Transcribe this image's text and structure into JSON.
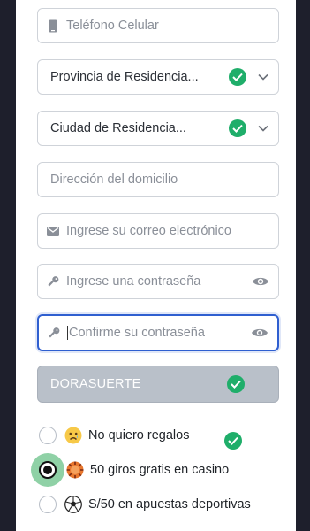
{
  "form": {
    "phone": {
      "placeholder": "Teléfono Celular",
      "icon": "phone-icon"
    },
    "province": {
      "value": "Provincia de Residencia...",
      "valid": true
    },
    "city": {
      "value": "Ciudad de Residencia...",
      "valid": true
    },
    "address": {
      "placeholder": "Dirección del domicilio"
    },
    "email": {
      "placeholder": "Ingrese su correo electrónico",
      "icon": "envelope-icon"
    },
    "password": {
      "placeholder": "Ingrese una contraseña",
      "icon": "key-icon"
    },
    "confirm_password": {
      "placeholder": "Confirme su contraseña",
      "icon": "key-icon"
    },
    "promo_code": {
      "value": "DORASUERTE",
      "valid": true
    }
  },
  "bonus_options": [
    {
      "label": "No quiero regalos",
      "emoji": "sad-face-icon",
      "selected": false
    },
    {
      "label": "50 giros gratis en casino",
      "emoji": "casino-chip-icon",
      "selected": true
    },
    {
      "label": "S/50 en apuestas deportivas",
      "emoji": "soccer-ball-icon",
      "selected": false
    }
  ],
  "colors": {
    "valid_green": "#1fae6a",
    "focus_blue": "#2f5fd0",
    "disabled_fill": "#b9c0c9",
    "selected_halo": "#8fd1a6",
    "page_background": "#1e1f2c"
  }
}
